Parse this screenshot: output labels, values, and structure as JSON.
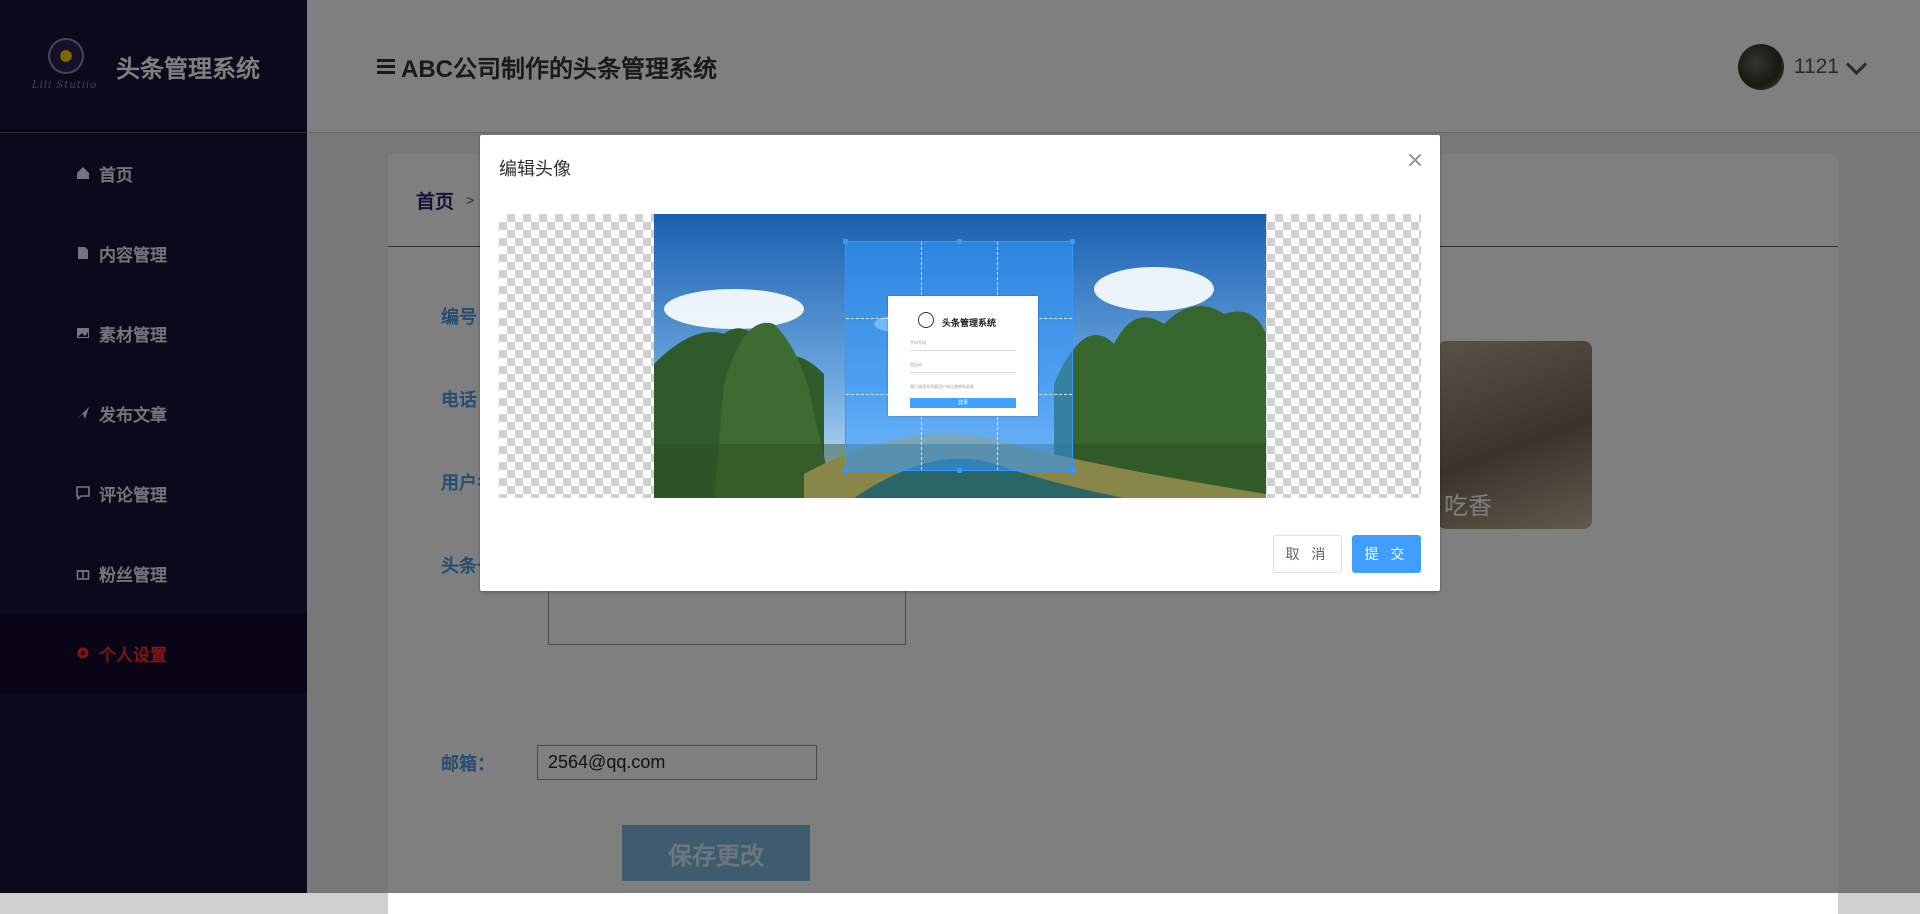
{
  "sidebar": {
    "brand_title": "头条管理系统",
    "brand_script": "Lili Stutiio",
    "items": [
      {
        "label": "首页",
        "icon": "home-icon"
      },
      {
        "label": "内容管理",
        "icon": "document-icon"
      },
      {
        "label": "素材管理",
        "icon": "image-icon"
      },
      {
        "label": "发布文章",
        "icon": "send-icon"
      },
      {
        "label": "评论管理",
        "icon": "comment-icon"
      },
      {
        "label": "粉丝管理",
        "icon": "gift-icon"
      },
      {
        "label": "个人设置",
        "icon": "settings-icon",
        "active": true
      }
    ]
  },
  "header": {
    "title": "ABC公司制作的头条管理系统",
    "username": "1121"
  },
  "main": {
    "breadcrumb_home": "首页",
    "breadcrumb_sep": ">",
    "labels": {
      "id": "编号",
      "phone": "电话",
      "username": "用户名",
      "intro": "头条号",
      "email": "邮箱："
    },
    "email_value": "2564@qq.com",
    "save_label": "保存更改",
    "avatar_caption": "吃香"
  },
  "dialog": {
    "title": "编辑头像",
    "cancel_label": "取 消",
    "submit_label": "提 交",
    "preview": {
      "title": "头条管理系统",
      "field1": "手机号码",
      "field2": "验证码",
      "agree": "我已阅读并同意用户协议和隐私条款",
      "login": "登录"
    }
  },
  "colors": {
    "sidebar_bg": "#1b1238",
    "active_menu": "#ff2b2b",
    "primary": "#409eff",
    "label_blue": "#4d9be3"
  }
}
